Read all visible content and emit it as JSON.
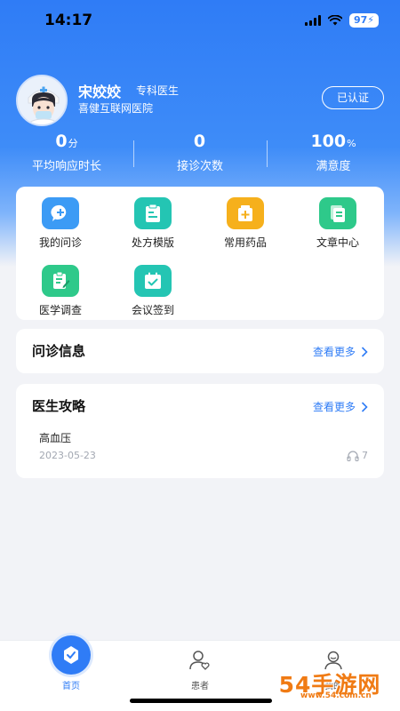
{
  "status_bar": {
    "time": "14:17",
    "battery": "97"
  },
  "profile": {
    "name": "宋姣姣",
    "title": "专科医生",
    "hospital": "喜健互联网医院",
    "verified_label": "已认证"
  },
  "stats": [
    {
      "value": "0",
      "unit": "分",
      "label": "平均响应时长"
    },
    {
      "value": "0",
      "unit": "",
      "label": "接诊次数"
    },
    {
      "value": "100",
      "unit": "%",
      "label": "满意度"
    }
  ],
  "menu": [
    {
      "label": "我的问诊",
      "icon": "chat-plus-icon",
      "color": "#3c9bf5"
    },
    {
      "label": "处方模版",
      "icon": "clipboard-icon",
      "color": "#24c5b3"
    },
    {
      "label": "常用药品",
      "icon": "medicine-box-icon",
      "color": "#f6b01c"
    },
    {
      "label": "文章中心",
      "icon": "documents-icon",
      "color": "#2ec98a"
    },
    {
      "label": "医学调查",
      "icon": "survey-edit-icon",
      "color": "#2ec98a"
    },
    {
      "label": "会议签到",
      "icon": "calendar-check-icon",
      "color": "#24c5b3"
    }
  ],
  "inquiry": {
    "title": "问诊信息",
    "more": "查看更多"
  },
  "guide": {
    "title": "医生攻略",
    "more": "查看更多",
    "articles": [
      {
        "title": "高血压",
        "date": "2023-05-23",
        "listens": "7"
      }
    ]
  },
  "tabs": [
    {
      "label": "首页",
      "icon": "home-icon",
      "active": true
    },
    {
      "label": "患者",
      "icon": "patient-icon",
      "active": false
    },
    {
      "label": "我的",
      "icon": "profile-icon",
      "active": false
    }
  ],
  "watermark": {
    "text": "54手游网",
    "sub": "www.54.com.cn"
  },
  "colors": {
    "accent": "#2f7cf6",
    "background": "#f2f3f7",
    "watermark": "#f07b14"
  }
}
